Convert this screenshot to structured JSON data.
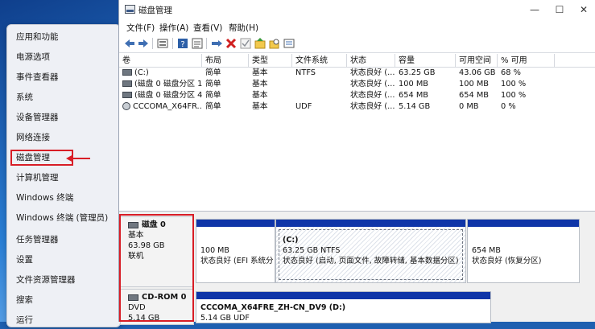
{
  "winx_menu": {
    "items": [
      {
        "label": "应用和功能"
      },
      {
        "label": "电源选项"
      },
      {
        "label": "事件查看器"
      },
      {
        "label": "系统"
      },
      {
        "label": "设备管理器"
      },
      {
        "label": "网络连接"
      },
      {
        "label": "磁盘管理"
      },
      {
        "label": "计算机管理"
      },
      {
        "label": "Windows 终端"
      },
      {
        "label": "Windows 终端 (管理员)"
      },
      {
        "label": "任务管理器"
      },
      {
        "label": "设置"
      },
      {
        "label": "文件资源管理器"
      },
      {
        "label": "搜索"
      },
      {
        "label": "运行"
      }
    ],
    "highlight_color": "#d81d26"
  },
  "window": {
    "title": "磁盘管理",
    "minimize_glyph": "—",
    "maximize_glyph": "☐",
    "close_glyph": "✕",
    "menu": [
      "文件(F)",
      "操作(A)",
      "查看(V)",
      "帮助(H)"
    ]
  },
  "toolbar_icons": [
    "back-arrow-icon",
    "forward-arrow-icon",
    "disk-view-icon",
    "help-icon",
    "properties-icon",
    "connect-icon",
    "delete-icon",
    "check-icon",
    "open-folder-icon",
    "search-folder-icon",
    "details-icon"
  ],
  "volume_list": {
    "columns": [
      "卷",
      "布局",
      "类型",
      "文件系统",
      "状态",
      "容量",
      "可用空间",
      "% 可用"
    ],
    "rows": [
      {
        "volume": "(C:)",
        "layout": "简单",
        "type": "基本",
        "fs": "NTFS",
        "status": "状态良好 (...",
        "capacity": "63.25 GB",
        "free": "43.06 GB",
        "pct": "68 %",
        "icon": "disk"
      },
      {
        "volume": "(磁盘 0 磁盘分区 1)",
        "layout": "简单",
        "type": "基本",
        "fs": "",
        "status": "状态良好 (...",
        "capacity": "100 MB",
        "free": "100 MB",
        "pct": "100 %",
        "icon": "disk"
      },
      {
        "volume": "(磁盘 0 磁盘分区 4)",
        "layout": "简单",
        "type": "基本",
        "fs": "",
        "status": "状态良好 (...",
        "capacity": "654 MB",
        "free": "654 MB",
        "pct": "100 %",
        "icon": "disk"
      },
      {
        "volume": "CCCOMA_X64FR...",
        "layout": "简单",
        "type": "基本",
        "fs": "UDF",
        "status": "状态良好 (...",
        "capacity": "5.14 GB",
        "free": "0 MB",
        "pct": "0 %",
        "icon": "cd"
      }
    ]
  },
  "disks": [
    {
      "name": "磁盘 0",
      "type": "基本",
      "size": "63.98 GB",
      "state": "联机",
      "partitions": [
        {
          "size": "100 MB",
          "status": "状态良好 (EFI 系统分"
        },
        {
          "name": "(C:)",
          "size": "63.25 GB NTFS",
          "status": "状态良好 (启动, 页面文件, 故障转储, 基本数据分区)"
        },
        {
          "size": "654 MB",
          "status": "状态良好 (恢复分区)"
        }
      ]
    },
    {
      "name": "CD-ROM 0",
      "type": "DVD",
      "size": "5.14 GB",
      "partitions": [
        {
          "name": "CCCOMA_X64FRE_ZH-CN_DV9  (D:)",
          "size": "5.14 GB UDF"
        }
      ]
    }
  ],
  "colors": {
    "partition_bar": "#0f35a8",
    "annotation_red": "#d81d26"
  }
}
